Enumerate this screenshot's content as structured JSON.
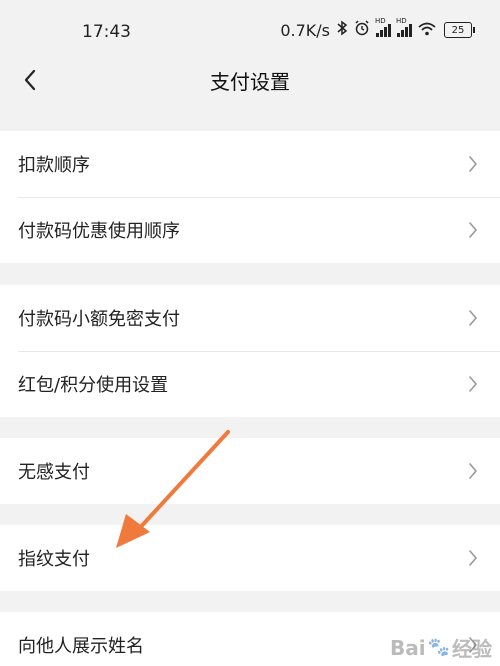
{
  "status_bar": {
    "time": "17:43",
    "network_speed": "0.7K/s",
    "battery": "25",
    "hd_label_1": "HD",
    "hd_label_2": "HD"
  },
  "nav": {
    "title": "支付设置",
    "back_icon": "chevron-left-icon"
  },
  "groups": [
    {
      "items": [
        {
          "label": "扣款顺序"
        },
        {
          "label": "付款码优惠使用顺序"
        }
      ]
    },
    {
      "items": [
        {
          "label": "付款码小额免密支付"
        },
        {
          "label": "红包/积分使用设置"
        }
      ]
    },
    {
      "items": [
        {
          "label": "无感支付"
        }
      ]
    },
    {
      "items": [
        {
          "label": "指纹支付"
        }
      ]
    },
    {
      "items": [
        {
          "label": "向他人展示姓名"
        }
      ]
    }
  ],
  "annotation": {
    "color": "#f07a3c"
  },
  "watermark": {
    "text_a": "Bai",
    "text_b": "经验"
  }
}
